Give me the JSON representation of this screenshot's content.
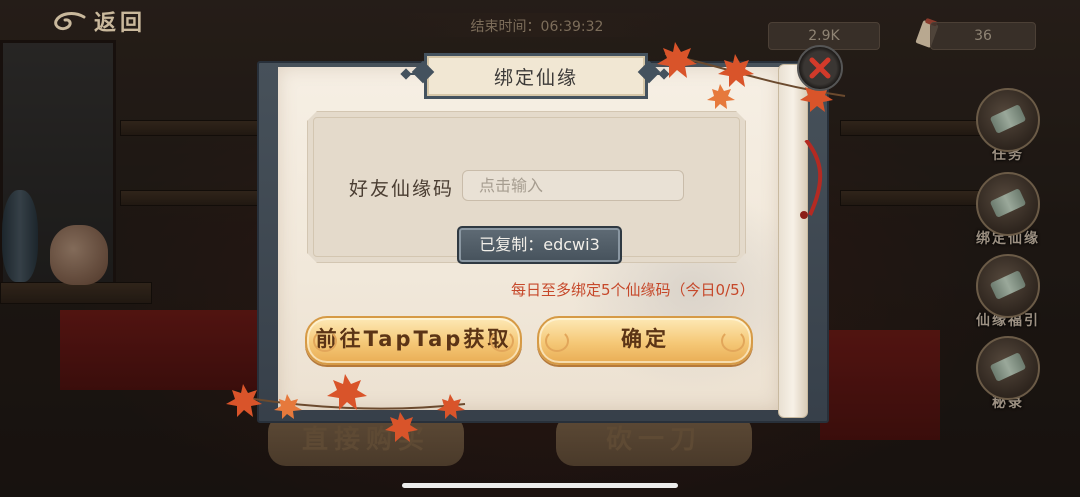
{
  "top_bar": {
    "back_label": "返回",
    "timer_text": "结束时间：06:39:32",
    "resource_1": "2.9K",
    "resource_2": "36"
  },
  "side_menu": {
    "items": [
      {
        "label": "任务",
        "icon": "scroll-icon"
      },
      {
        "label": "绑定仙缘",
        "icon": "scroll-icon"
      },
      {
        "label": "仙缘福引",
        "icon": "scroll-icon"
      },
      {
        "label": "秘录",
        "icon": "scroll-icon"
      }
    ]
  },
  "bottom_buttons": {
    "buy_label": "直接购买",
    "cut_label": "砍一刀"
  },
  "dialog": {
    "title": "绑定仙缘",
    "field_label": "好友仙缘码",
    "input_placeholder": "点击输入",
    "input_value": "",
    "copied_label": "已复制：edcwi3",
    "limit_text": "每日至多绑定5个仙缘码（今日0/5）",
    "taptap_button": "前往TapTap获取",
    "confirm_button": "确定"
  },
  "colors": {
    "accent_gold": "#f5c877",
    "limit_red": "#c6482a",
    "frame_slate": "#44525e",
    "close_red": "#d23a2a"
  }
}
